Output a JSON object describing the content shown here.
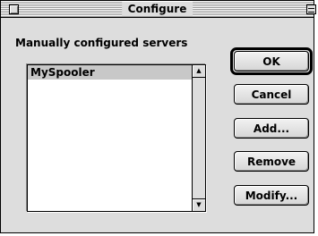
{
  "window": {
    "title": "Configure"
  },
  "servers": {
    "label": "Manually configured servers",
    "items": [
      "MySpooler"
    ]
  },
  "buttons": {
    "ok": "OK",
    "cancel": "Cancel",
    "add": "Add...",
    "remove": "Remove",
    "modify": "Modify..."
  },
  "icons": {
    "close": "close-box-icon",
    "collapse": "collapse-box-icon",
    "scroll_up": "scroll-up-arrow-icon",
    "scroll_down": "scroll-down-arrow-icon"
  },
  "colors": {
    "window_bg": "#dddddd",
    "selection_bg": "#c8c8c8"
  }
}
